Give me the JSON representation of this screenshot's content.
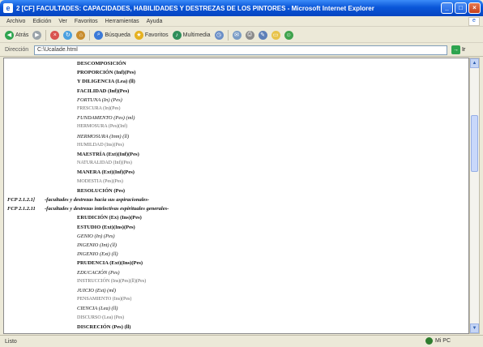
{
  "window": {
    "icon": "ie-icon",
    "title": "2 [CF] FACULTADES: CAPACIDADES, HABILIDADES Y DESTREZAS DE LOS PINTORES - Microsoft Internet Explorer",
    "minimize": "_",
    "maximize": "□",
    "close": "×"
  },
  "menu": {
    "items": [
      "Archivo",
      "Edición",
      "Ver",
      "Favoritos",
      "Herramientas",
      "Ayuda"
    ],
    "logo": "e"
  },
  "toolbar": {
    "back": "Atrás",
    "search": "Búsqueda",
    "favorites": "Favoritos",
    "multimedia": "Multimedia"
  },
  "address": {
    "label": "Dirección",
    "value": "C:\\Ucalade.html",
    "go": "Ir"
  },
  "document": {
    "lines": [
      {
        "code": "",
        "text": "DESCOMPOSICIÓN",
        "style": "bold"
      },
      {
        "code": "",
        "text": "PROPORCIÓN (Inf)(Pes)",
        "style": "bold"
      },
      {
        "code": "",
        "text": "Y DILIGENCIA (Lea) (ll)",
        "style": "bold"
      },
      {
        "code": "",
        "text": "FACILIDAD (Inf)(Pes)",
        "style": "bold"
      },
      {
        "code": "",
        "text": "FORTUNA (In) (Pes)",
        "style": "italic"
      },
      {
        "code": "",
        "text": "FRESCURA (In)(Pes)",
        "style": "faint"
      },
      {
        "code": "",
        "text": "FUNDAMENTO (Pes) (ml)",
        "style": "italic"
      },
      {
        "code": "",
        "text": "HERMOSURA (Pes)(Inf)",
        "style": "faint"
      },
      {
        "code": "",
        "text": "HERMOSURA (Inm) (ll)",
        "style": "italic"
      },
      {
        "code": "",
        "text": "HUMILDAD (Ins)(Pes)",
        "style": "faint"
      },
      {
        "code": "",
        "text": "MAESTRÍA (Ext)(Inf)(Pes)",
        "style": "bold"
      },
      {
        "code": "",
        "text": "NATURALIDAD (Inf)(Pes)",
        "style": "faint"
      },
      {
        "code": "",
        "text": "MANERA (Ext)(Inf)(Pes)",
        "style": "bold"
      },
      {
        "code": "",
        "text": "MODESTIA (Pes)(Pes)",
        "style": "faint"
      },
      {
        "code": "",
        "text": "RESOLUCIÓN (Pes)",
        "style": "bold"
      },
      {
        "code": "FCP 2.1.2.1]",
        "text": "-facultades y destrezas hacia sus aspiracionales-",
        "style": "bold-italic"
      },
      {
        "code": "FCP 2.1.2.11",
        "text": "-facultades y destrezas intelectivas espirituales generales-",
        "style": "bold-italic"
      },
      {
        "code": "",
        "text": "ERUDICIÓN (Ex) (Ins)(Pes)",
        "style": "bold"
      },
      {
        "code": "",
        "text": "ESTUDIO (Ext)(Ins)(Pes)",
        "style": "bold"
      },
      {
        "code": "",
        "text": "GENIO (In) (Pes)",
        "style": "italic"
      },
      {
        "code": "",
        "text": "INGENIO (Int) (ll)",
        "style": "italic"
      },
      {
        "code": "",
        "text": "INGENIO (Ext) (ll)",
        "style": "italic"
      },
      {
        "code": "",
        "text": "PRUDENCIA (Ext)(Ins)(Pes)",
        "style": "bold"
      },
      {
        "code": "",
        "text": "EDUCACIÓN (Pes)",
        "style": "italic"
      },
      {
        "code": "",
        "text": "INSTRUCCIÓN (Ins)(Pes)(ll)(Pes)",
        "style": "faint"
      },
      {
        "code": "",
        "text": "JUICIO (Ext) (ml)",
        "style": "italic"
      },
      {
        "code": "",
        "text": "PENSAMIENTO (Ins)(Pes)",
        "style": "faint"
      },
      {
        "code": "",
        "text": "CIENCIA (Lea) (ll)",
        "style": "italic"
      },
      {
        "code": "",
        "text": "DISCURSO (Lea) (Pes)",
        "style": "faint"
      },
      {
        "code": "",
        "text": "DISCRECIÓN (Pes) (ll)",
        "style": "bold"
      }
    ]
  },
  "status": {
    "left": "Listo",
    "zone": "Mi PC"
  },
  "colors": {
    "titlebar": "#0a56d8",
    "chrome": "#ece9d8",
    "page": "#ffffff"
  }
}
